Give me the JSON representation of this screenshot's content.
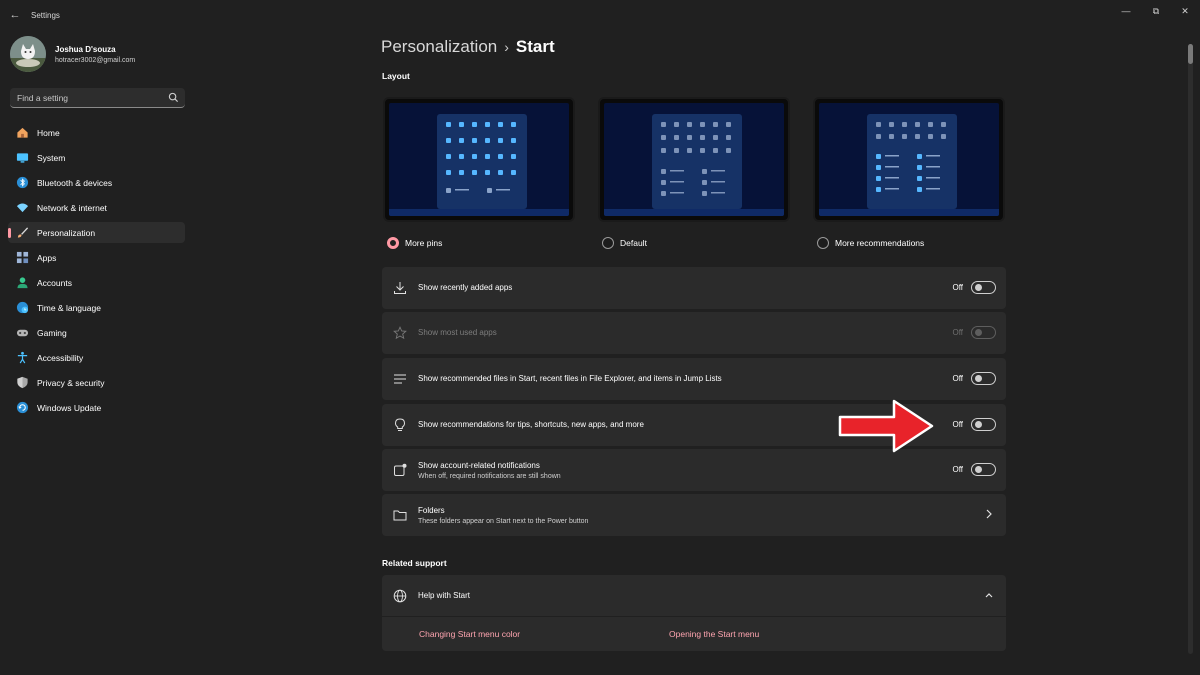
{
  "window": {
    "title": "Settings",
    "back_glyph": "←",
    "minimize_glyph": "—",
    "maximize_glyph": "⧉",
    "close_glyph": "✕"
  },
  "user": {
    "name": "Joshua D'souza",
    "email": "hotracer3002@gmail.com"
  },
  "search": {
    "placeholder": "Find a setting",
    "icon": "search-icon"
  },
  "sidebar": {
    "items": [
      {
        "label": "Home",
        "icon": "home-icon",
        "color": "#f0a35e"
      },
      {
        "label": "System",
        "icon": "monitor-icon",
        "color": "#4cc2ff"
      },
      {
        "label": "Bluetooth & devices",
        "icon": "bluetooth-icon",
        "color": "#4cc2ff"
      },
      {
        "label": "Network & internet",
        "icon": "wifi-icon",
        "color": "#7bd3ff"
      },
      {
        "label": "Personalization",
        "icon": "brush-icon",
        "color": "#f5b27a",
        "active": true
      },
      {
        "label": "Apps",
        "icon": "apps-icon",
        "color": "#9fb6d8"
      },
      {
        "label": "Accounts",
        "icon": "person-icon",
        "color": "#38c98f"
      },
      {
        "label": "Time & language",
        "icon": "globe-clock-icon",
        "color": "#4cc2ff"
      },
      {
        "label": "Gaming",
        "icon": "gamepad-icon",
        "color": "#b5b5b5"
      },
      {
        "label": "Accessibility",
        "icon": "accessibility-icon",
        "color": "#4cc2ff"
      },
      {
        "label": "Privacy & security",
        "icon": "shield-icon",
        "color": "#a8a8a8"
      },
      {
        "label": "Windows Update",
        "icon": "update-icon",
        "color": "#4cc2ff"
      }
    ]
  },
  "breadcrumb": {
    "parent": "Personalization",
    "separator": "›",
    "current": "Start"
  },
  "layout": {
    "section_title": "Layout",
    "options": [
      {
        "label": "More pins",
        "selected": true
      },
      {
        "label": "Default",
        "selected": false
      },
      {
        "label": "More recommendations",
        "selected": false
      }
    ]
  },
  "settings": [
    {
      "title": "Show recently added apps",
      "subtitle": "",
      "state": "Off",
      "icon": "download-icon",
      "disabled": false
    },
    {
      "title": "Show most used apps",
      "subtitle": "",
      "state": "Off",
      "icon": "star-icon",
      "disabled": true
    },
    {
      "title": "Show recommended files in Start, recent files in File Explorer, and items in Jump Lists",
      "subtitle": "",
      "state": "Off",
      "icon": "list-icon",
      "disabled": false
    },
    {
      "title": "Show recommendations for tips, shortcuts, new apps, and more",
      "subtitle": "",
      "state": "Off",
      "icon": "lightbulb-icon",
      "disabled": false
    },
    {
      "title": "Show account-related notifications",
      "subtitle": "When off, required notifications are still shown",
      "state": "Off",
      "icon": "notification-icon",
      "disabled": false
    }
  ],
  "folders": {
    "title": "Folders",
    "subtitle": "These folders appear on Start next to the Power button",
    "icon": "folder-icon"
  },
  "related_support": {
    "section_title": "Related support",
    "help_title": "Help with Start",
    "help_icon": "globe-icon",
    "links": [
      "Changing Start menu color",
      "Opening the Start menu"
    ]
  },
  "colors": {
    "accent": "#ff99a4",
    "link": "#ffa5b0",
    "background": "#202020",
    "card": "#2b2b2b",
    "annotation_arrow": "#e8232a"
  }
}
